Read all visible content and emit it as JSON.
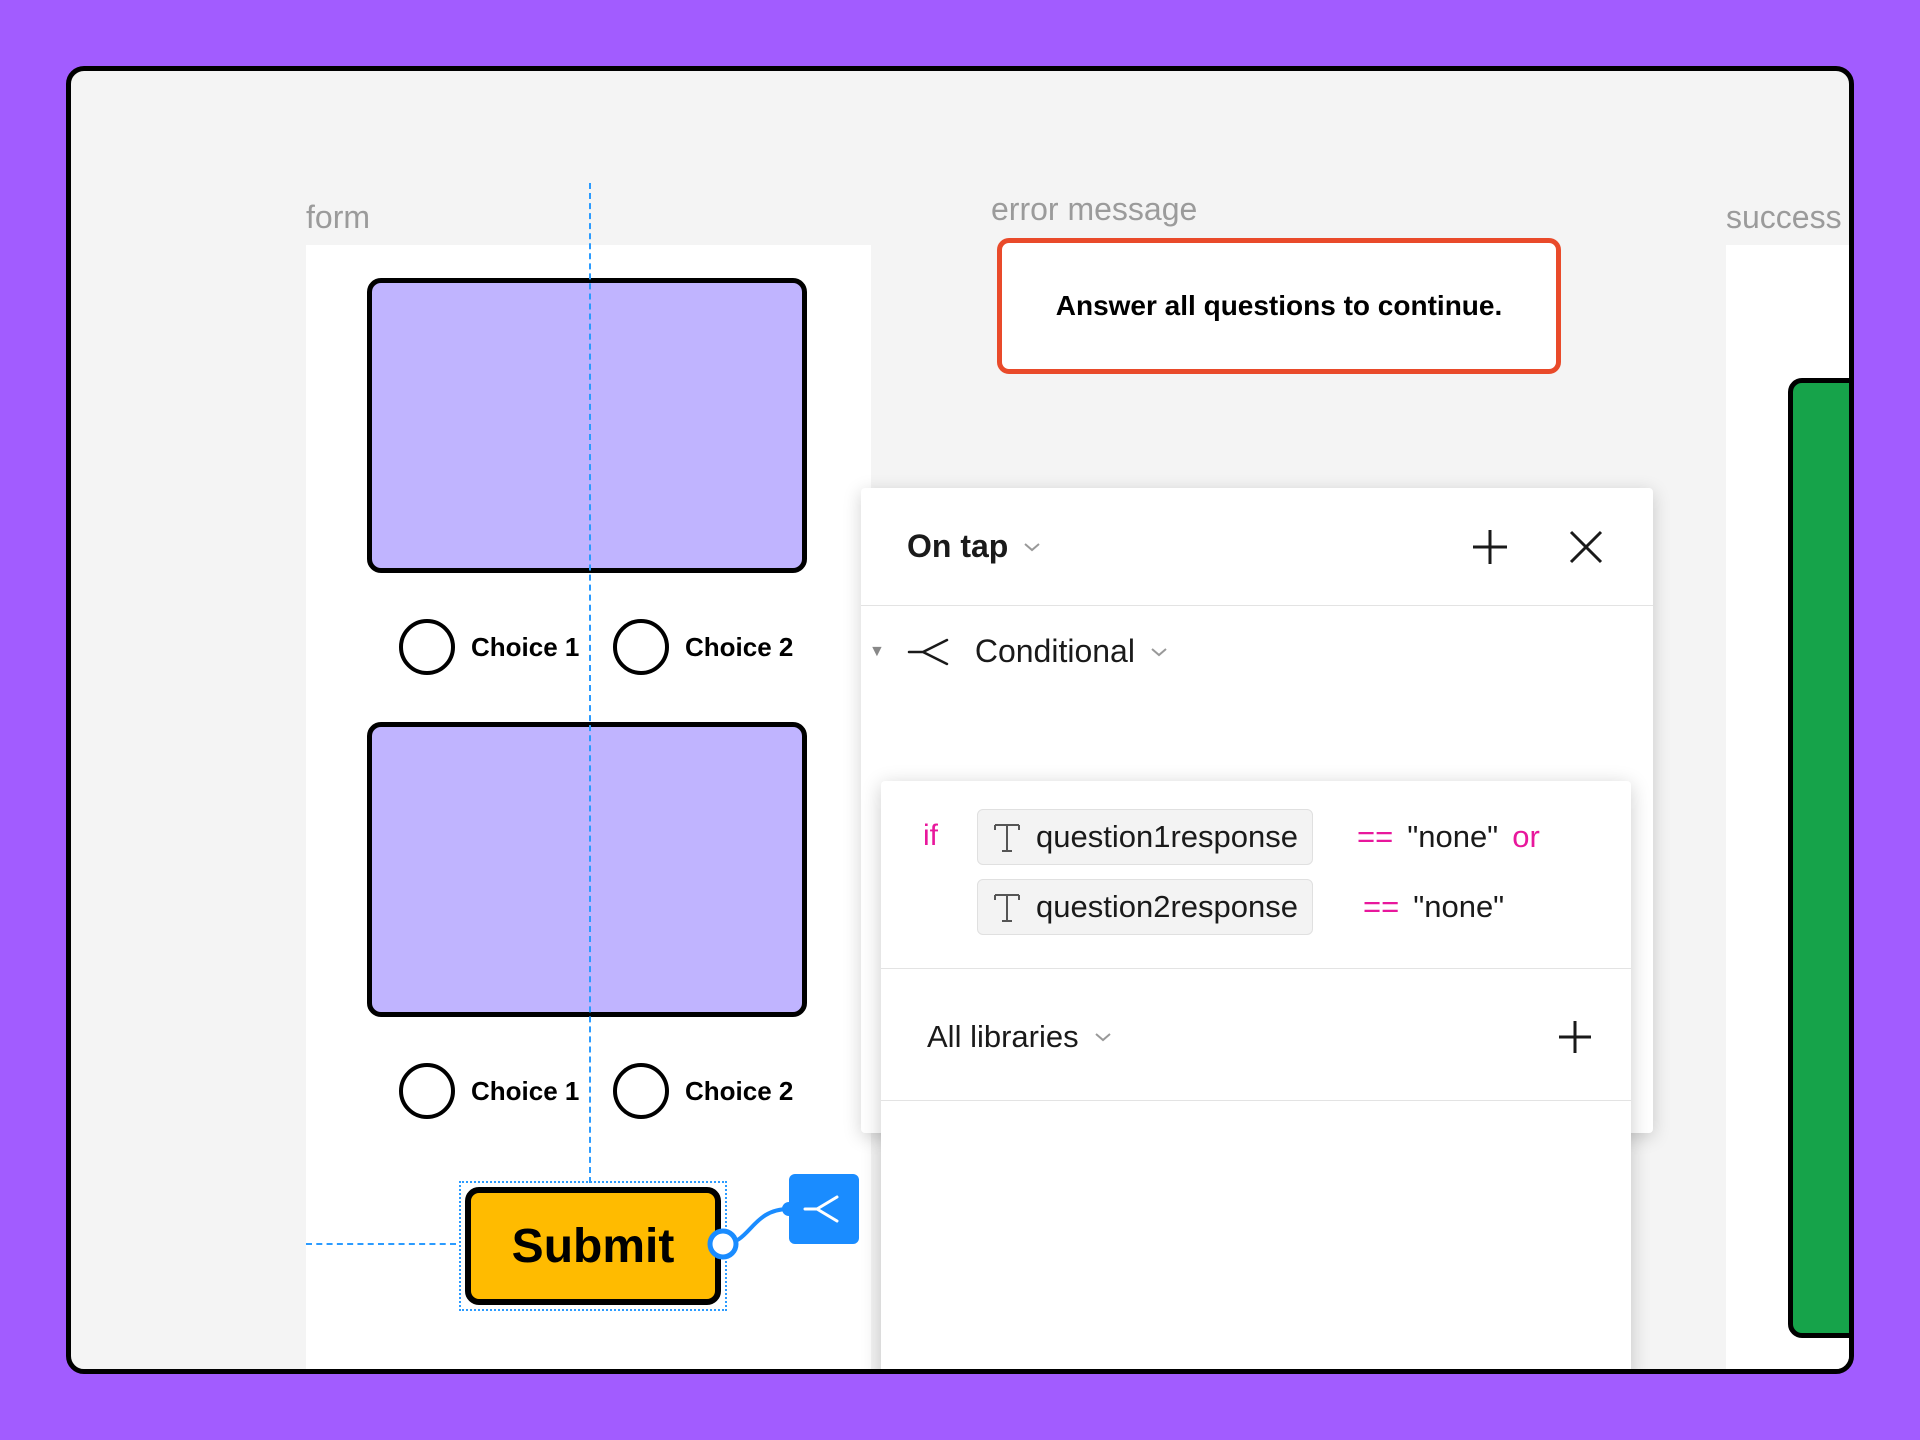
{
  "frames": {
    "form_label": "form",
    "success_label": "success"
  },
  "questions": [
    {
      "choices": [
        "Choice 1",
        "Choice 2"
      ]
    },
    {
      "choices": [
        "Choice 1",
        "Choice 2"
      ]
    }
  ],
  "submit": {
    "label": "Submit"
  },
  "error": {
    "label": "error message",
    "text": "Answer all questions to continue."
  },
  "panel": {
    "trigger": "On tap",
    "action": "Conditional",
    "condition": {
      "if_kw": "if",
      "clause1": {
        "variable": "question1response",
        "op": "==",
        "value": "\"none\"",
        "joiner": "or"
      },
      "clause2": {
        "variable": "question2response",
        "op": "==",
        "value": "\"none\""
      }
    },
    "libraries": "All libraries"
  },
  "colors": {
    "background": "#a25cff",
    "card": "#c0b4ff",
    "submit": "#ffbb00",
    "error_border": "#e94a2a",
    "success": "#16a34a",
    "keyword": "#e8179c",
    "badge": "#1a8cff"
  },
  "icons": [
    "chevron-down-icon",
    "plus-icon",
    "close-icon",
    "branch-icon",
    "text-variable-icon",
    "caret-down-icon"
  ]
}
